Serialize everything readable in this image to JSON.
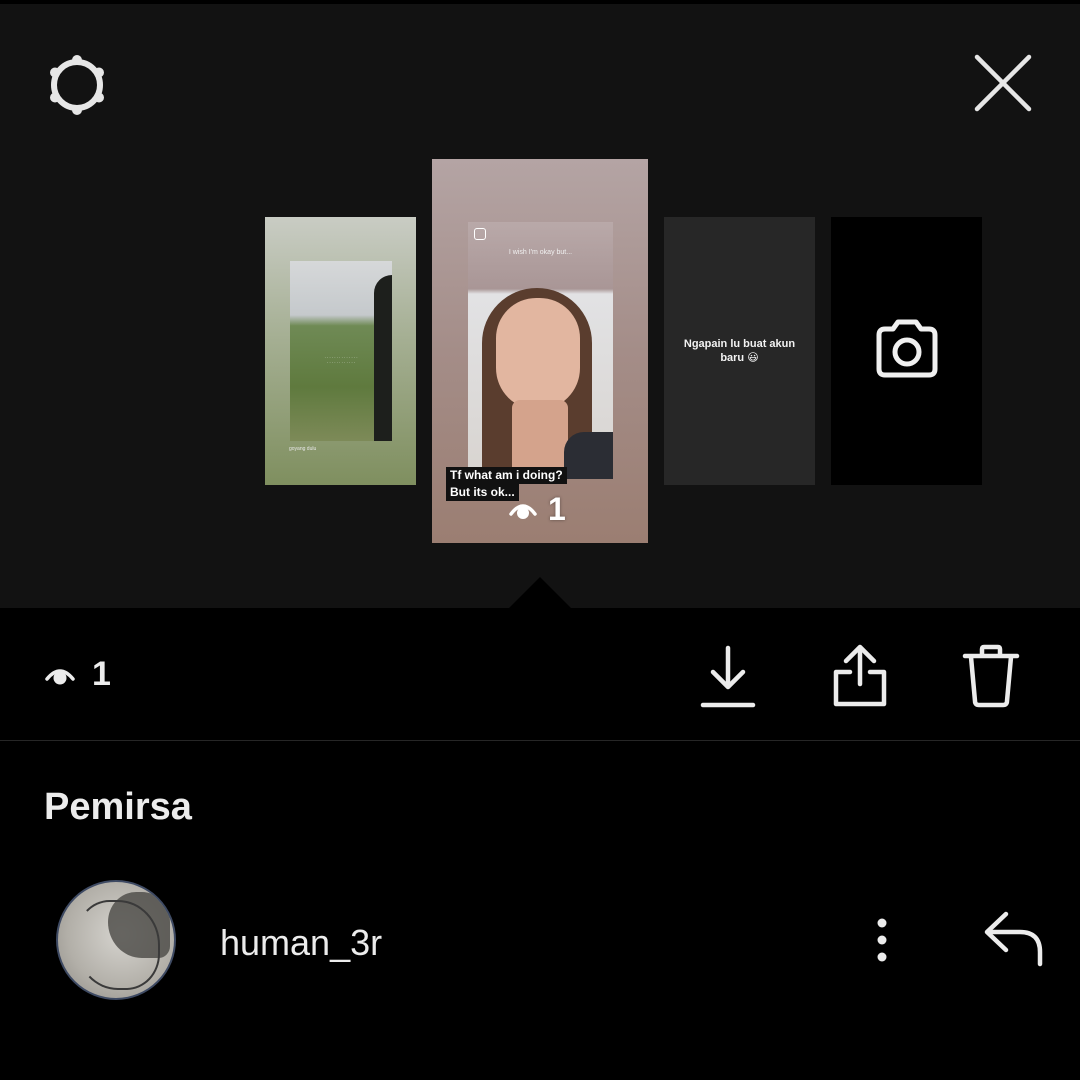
{
  "header": {
    "settings_icon": "gear-icon",
    "close_icon": "close-icon"
  },
  "stories": [
    {
      "id": "story-1",
      "caption": "",
      "small_text": "goyang dulu"
    },
    {
      "id": "story-2",
      "caption_top": "I wish I'm okay but...",
      "caption_line1": "Tf what am i doing?",
      "caption_line2": "But its ok...",
      "views": "1"
    },
    {
      "id": "story-3",
      "text": "Ngapain lu buat akun baru 😃"
    },
    {
      "id": "story-4",
      "icon": "camera-icon"
    }
  ],
  "action_bar": {
    "views_count": "1",
    "download_icon": "download-icon",
    "share_icon": "share-icon",
    "delete_icon": "trash-icon"
  },
  "viewers": {
    "title": "Pemirsa",
    "items": [
      {
        "username": "human_3r",
        "more_icon": "more-vertical-icon",
        "reply_icon": "reply-icon"
      }
    ]
  },
  "colors": {
    "panel_bg": "#121212",
    "page_bg": "#000000",
    "text": "#ececec"
  }
}
